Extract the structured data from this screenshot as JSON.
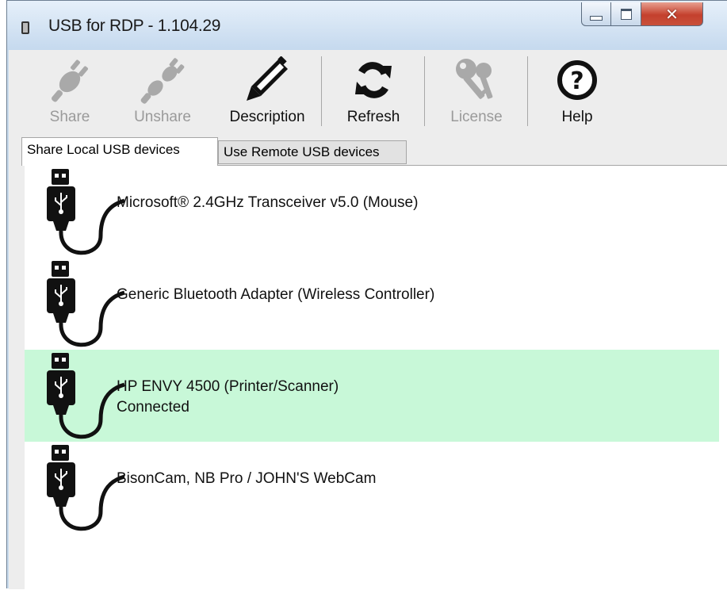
{
  "window": {
    "title": "USB for RDP - 1.104.29",
    "controls": {
      "minimize": "minimize",
      "maximize": "maximize",
      "close": "✕"
    }
  },
  "toolbar": [
    {
      "id": "share",
      "label": "Share",
      "enabled": false,
      "icon": "plug-icon"
    },
    {
      "id": "unshare",
      "label": "Unshare",
      "enabled": false,
      "icon": "unplug-icon"
    },
    {
      "id": "description",
      "label": "Description",
      "enabled": true,
      "icon": "pencil-icon"
    },
    {
      "id": "refresh",
      "label": "Refresh",
      "enabled": true,
      "icon": "refresh-icon"
    },
    {
      "id": "license",
      "label": "License",
      "enabled": false,
      "icon": "keys-icon"
    },
    {
      "id": "help",
      "label": "Help",
      "enabled": true,
      "icon": "help-icon",
      "glyph": "?"
    }
  ],
  "tabs": [
    {
      "label": "Share Local USB devices",
      "active": true
    },
    {
      "label": "Use Remote USB devices",
      "active": false
    }
  ],
  "devices": [
    {
      "name": "Microsoft® 2.4GHz Transceiver v5.0 (Mouse)",
      "status": "",
      "selected": false
    },
    {
      "name": "Generic Bluetooth Adapter (Wireless Controller)",
      "status": "",
      "selected": false
    },
    {
      "name": "HP ENVY 4500 (Printer/Scanner)",
      "status": "Connected",
      "selected": true
    },
    {
      "name": "BisonCam, NB Pro / JOHN'S WebCam",
      "status": "",
      "selected": false
    }
  ],
  "colors": {
    "selected_row": "#c8f8d8",
    "disabled_icon": "#a9a9a9",
    "enabled_icon": "#111111"
  }
}
